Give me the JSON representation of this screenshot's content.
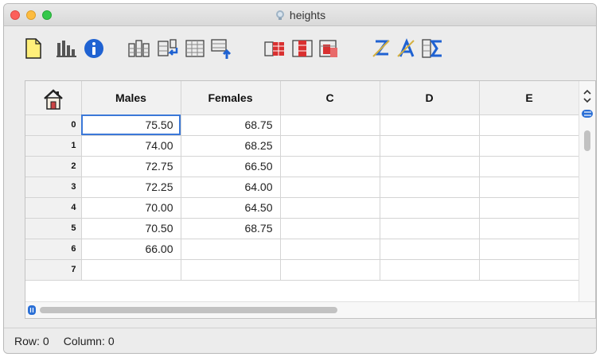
{
  "window": {
    "title": "heights"
  },
  "toolbar": {
    "buttons": [
      {
        "name": "new-sheet-icon"
      },
      {
        "name": "chart-icon"
      },
      {
        "name": "info-icon"
      },
      {
        "name": "insert-column-icon"
      },
      {
        "name": "insert-row-icon"
      },
      {
        "name": "append-row-icon"
      },
      {
        "name": "add-row-up-icon"
      },
      {
        "name": "delete-column-icon"
      },
      {
        "name": "delete-row-icon"
      },
      {
        "name": "clear-cells-icon"
      },
      {
        "name": "sort-z-icon"
      },
      {
        "name": "sort-a-icon"
      },
      {
        "name": "sum-icon"
      }
    ]
  },
  "grid": {
    "columns": [
      "Males",
      "Females",
      "C",
      "D",
      "E"
    ],
    "row_labels": [
      "0",
      "1",
      "2",
      "3",
      "4",
      "5",
      "6",
      "7"
    ],
    "rows": [
      [
        "75.50",
        "68.75",
        "",
        "",
        ""
      ],
      [
        "74.00",
        "68.25",
        "",
        "",
        ""
      ],
      [
        "72.75",
        "66.50",
        "",
        "",
        ""
      ],
      [
        "72.25",
        "64.00",
        "",
        "",
        ""
      ],
      [
        "70.00",
        "64.50",
        "",
        "",
        ""
      ],
      [
        "70.50",
        "68.75",
        "",
        "",
        ""
      ],
      [
        "66.00",
        "",
        "",
        "",
        ""
      ],
      [
        "",
        "",
        "",
        "",
        ""
      ]
    ],
    "selected_cell": {
      "row": 0,
      "column": 0
    }
  },
  "status": {
    "row_label": "Row:",
    "row_value": "0",
    "column_label": "Column:",
    "column_value": "0"
  },
  "colors": {
    "selection": "#3b78d8",
    "header_bg": "#f1f1f1",
    "accent_blue": "#1f62d2",
    "accent_red": "#d93030"
  }
}
